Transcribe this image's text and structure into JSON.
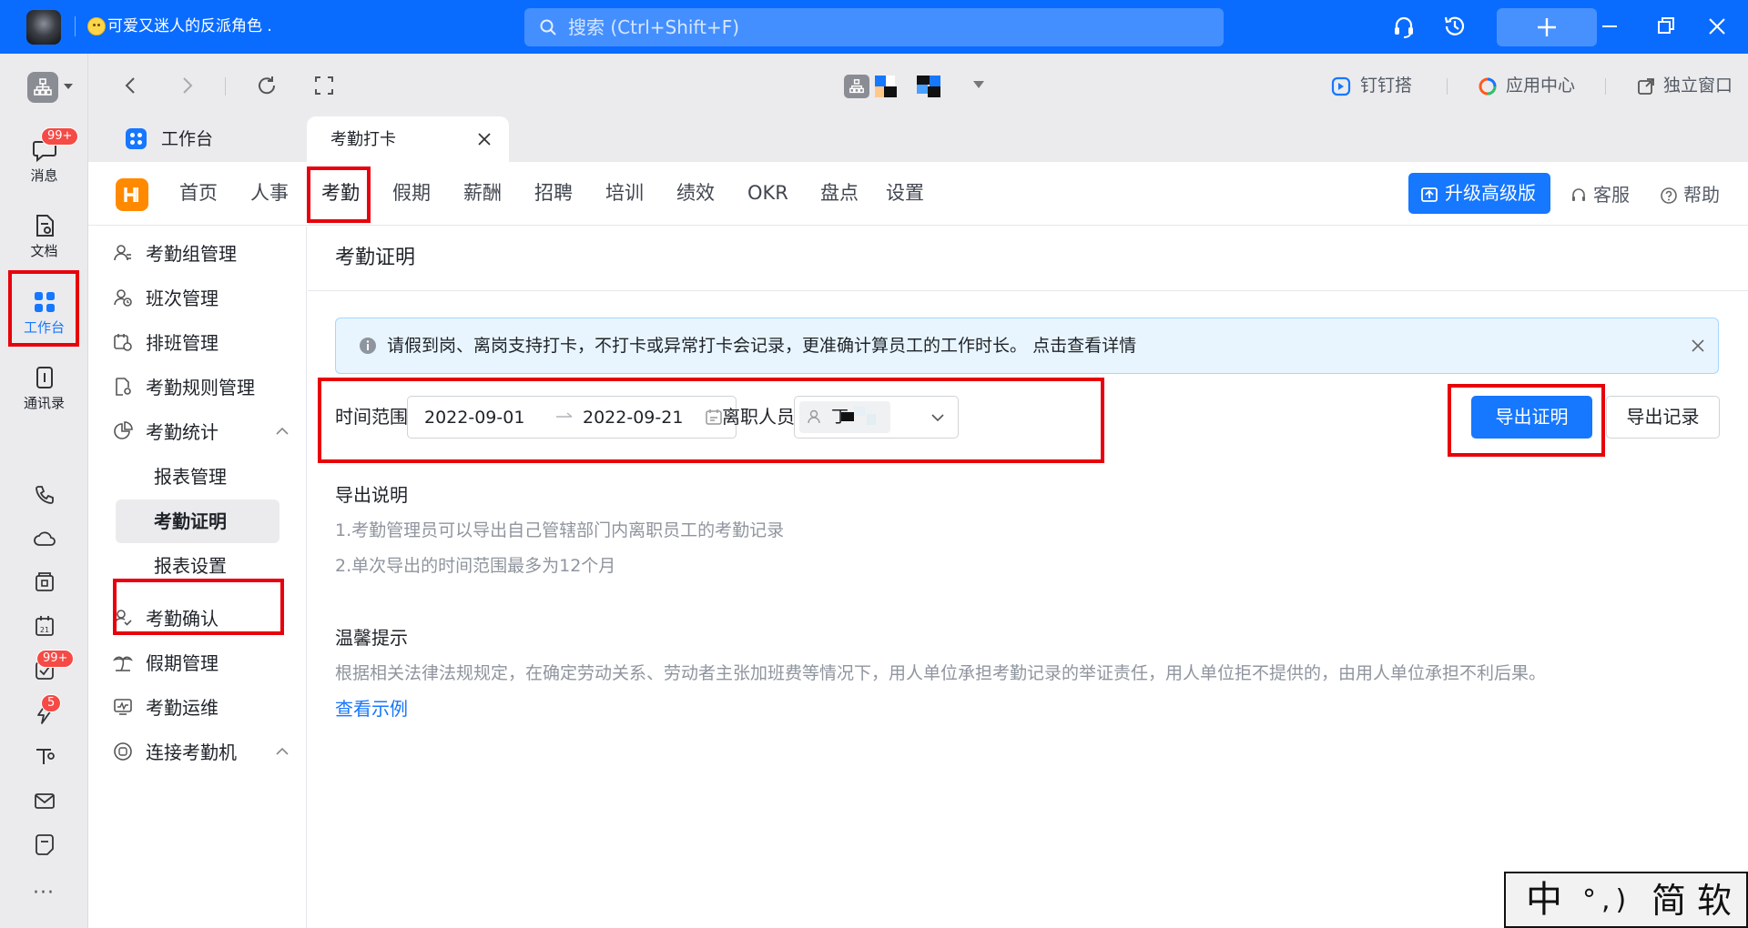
{
  "titlebar": {
    "status_text": "可爱又迷人的反派角色 .",
    "search_placeholder": "搜索 (Ctrl+Shift+F)"
  },
  "rail": {
    "items": [
      {
        "label": "消息",
        "badge": "99+"
      },
      {
        "label": "文档"
      },
      {
        "label": "工作台"
      },
      {
        "label": "通讯录"
      }
    ],
    "small_badges": [
      "99+",
      "5"
    ],
    "more": "···"
  },
  "toolbar": {
    "tools": [
      "钉钉搭",
      "应用中心",
      "独立窗口"
    ]
  },
  "tabs": [
    {
      "label": "工作台"
    },
    {
      "label": "考勤打卡"
    }
  ],
  "topnav": {
    "logo": "H",
    "modules": [
      "首页",
      "人事",
      "考勤",
      "假期",
      "薪酬",
      "招聘",
      "培训",
      "绩效",
      "OKR",
      "盘点",
      "设置"
    ],
    "active_module": "考勤",
    "upgrade": "升级高级版",
    "service": "客服",
    "help": "帮助"
  },
  "side_menu": {
    "items": [
      "考勤组管理",
      "班次管理",
      "排班管理",
      "考勤规则管理",
      "考勤统计"
    ],
    "sub_items": [
      "报表管理",
      "考勤证明",
      "报表设置"
    ],
    "items_after": [
      "考勤确认",
      "假期管理",
      "考勤运维",
      "连接考勤机"
    ]
  },
  "main": {
    "title": "考勤证明",
    "notice": "请假到岗、离岗支持打卡，不打卡或异常打卡会记录，更准确计算员工的工作时长。",
    "notice_link": "点击查看详情",
    "time_range_label": "时间范围",
    "start_date": "2022-09-01",
    "end_date": "2022-09-21",
    "employee_label": "离职人员",
    "employee_name": "丁",
    "export_proof": "导出证明",
    "export_records": "导出记录",
    "export_title": "导出说明",
    "export_notes": [
      "1.考勤管理员可以导出自己管辖部门内离职员工的考勤记录",
      "2.单次导出的时间范围最多为12个月"
    ],
    "tips_title": "温馨提示",
    "tips_text": "根据相关法律法规规定，在确定劳动关系、劳动者主张加班费等情况下，用人单位承担考勤记录的举证责任，用人单位拒不提供的，由用人单位承担不利后果。",
    "example_link": "查看示例"
  },
  "ime": {
    "mode": "中",
    "punct": "°,)",
    "charset": "简软"
  },
  "colors": {
    "titlebar": "#0a6cff",
    "accent": "#1677ff",
    "highlight": "#e8000b",
    "logo": "#ff8a00"
  }
}
